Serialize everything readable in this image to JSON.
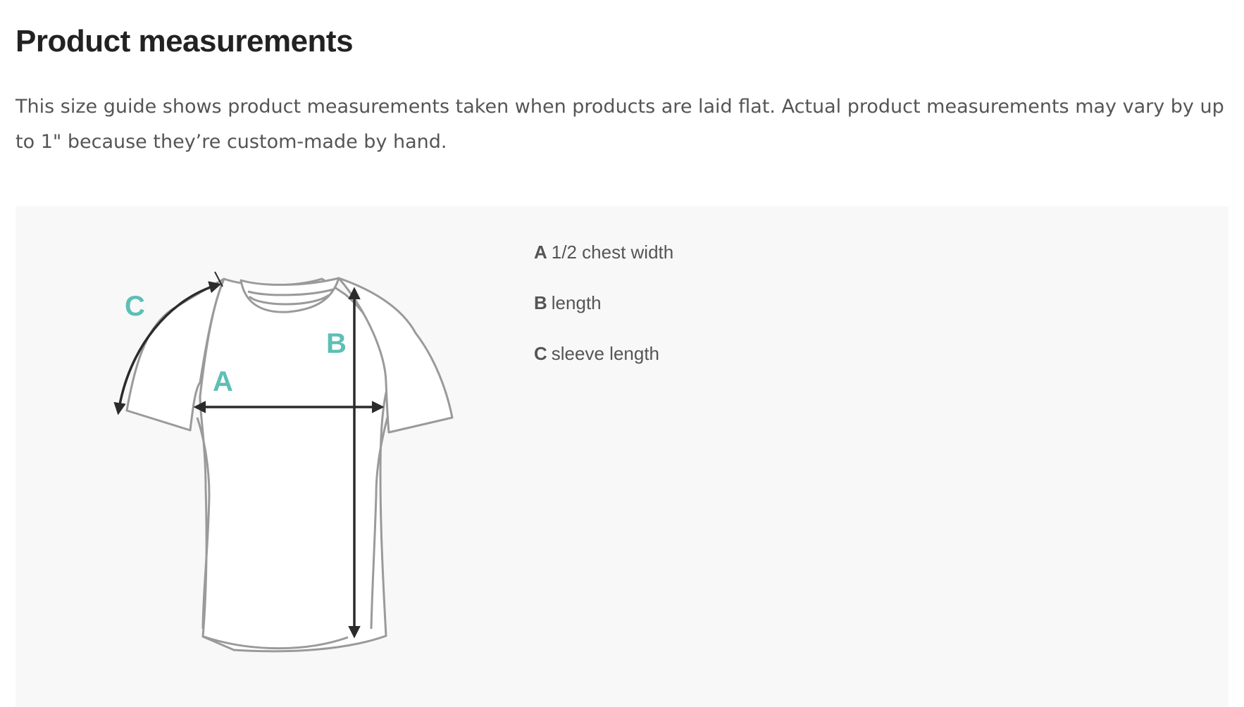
{
  "page": {
    "title": "Product measurements",
    "intro": "This size guide shows product measurements taken when products are laid flat. Actual product measurements may vary by up to 1\" because they’re custom-made by hand."
  },
  "diagram": {
    "labels": {
      "a": "A",
      "b": "B",
      "c": "C"
    },
    "colors": {
      "outline": "#9a9a9a",
      "arrow": "#2b2b2b",
      "label": "#5dbfb5",
      "panel": "#f8f8f9"
    }
  },
  "legend": {
    "items": [
      {
        "key": "A",
        "text": "1/2 chest width"
      },
      {
        "key": "B",
        "text": "length"
      },
      {
        "key": "C",
        "text": "sleeve length"
      }
    ]
  }
}
